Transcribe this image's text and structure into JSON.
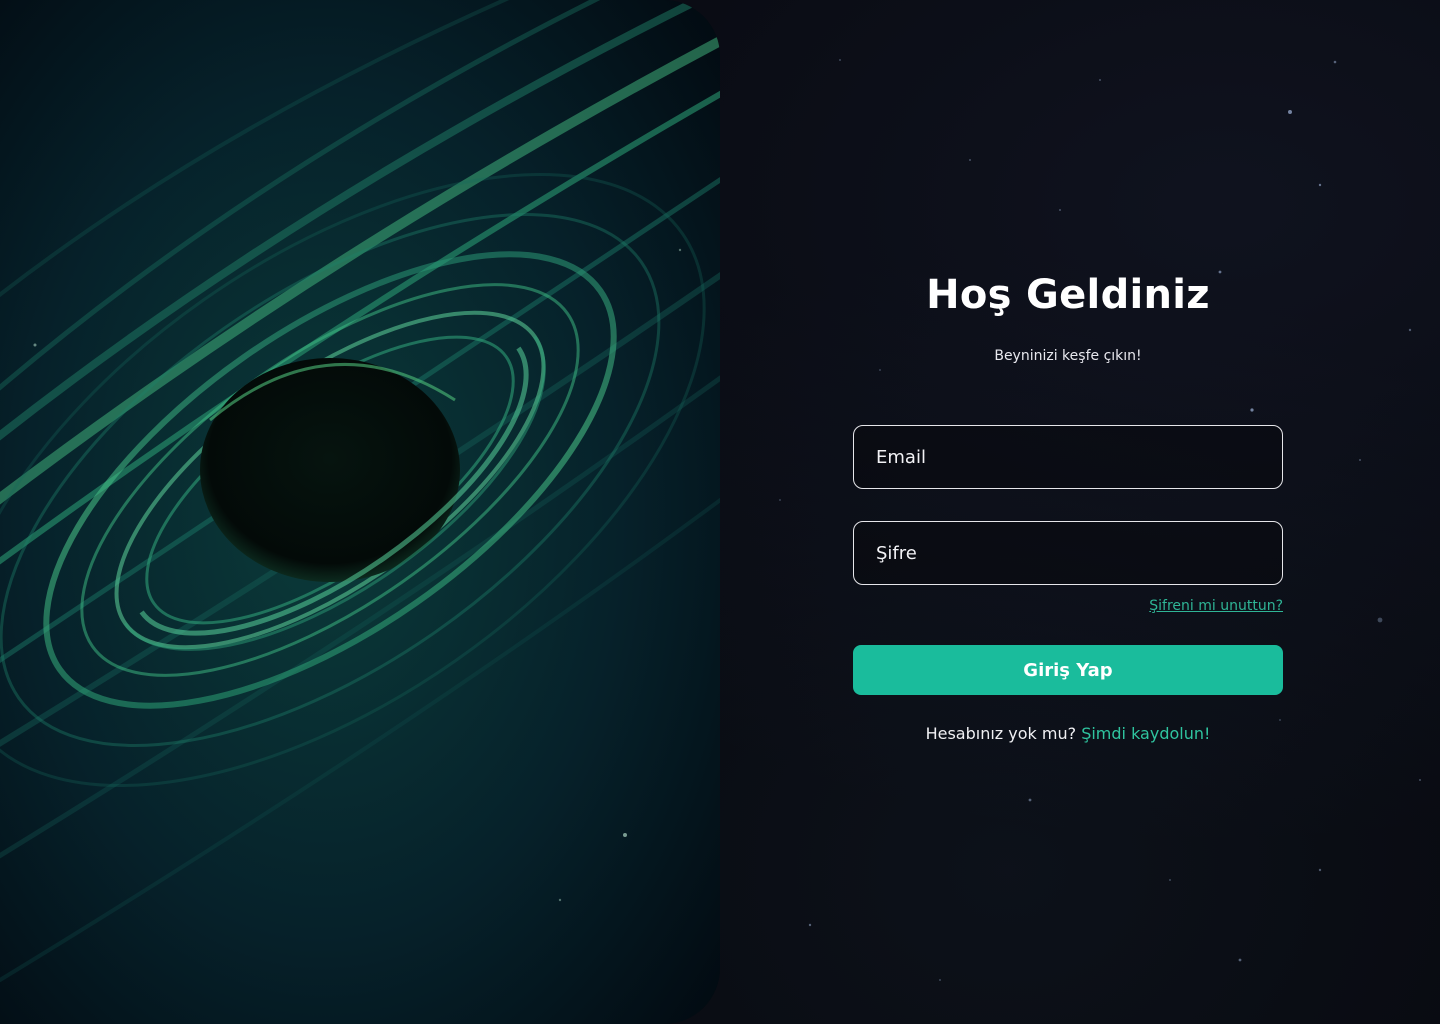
{
  "login": {
    "title": "Hoş Geldiniz",
    "subtitle": "Beyninizi keşfe çıkın!",
    "email_placeholder": "Email",
    "password_placeholder": "Şifre",
    "forgot_password": "Şifreni mi unuttun?",
    "submit_label": "Giriş Yap",
    "signup_prompt": "Hesabınız yok mu?",
    "signup_link": "Şimdi kaydolun!"
  },
  "colors": {
    "background": "#07080e",
    "accent": "#1abc9c",
    "link": "#2fb596",
    "input_border": "#e6e6ea"
  },
  "hero": {
    "image": "black-hole-galaxy-illustration"
  }
}
